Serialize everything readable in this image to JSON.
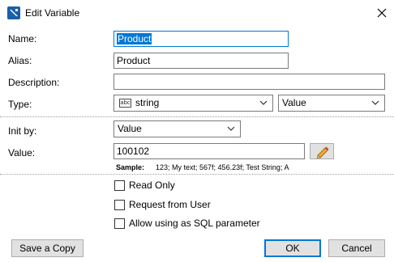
{
  "window": {
    "title": "Edit Variable",
    "icon": "app-icon",
    "close_icon": "close-icon"
  },
  "fields": {
    "name": {
      "label": "Name:",
      "value": "Product"
    },
    "alias": {
      "label": "Alias:",
      "value": "Product"
    },
    "description": {
      "label": "Description:",
      "value": ""
    },
    "type": {
      "label": "Type:",
      "icon_text": "abc",
      "value": "string",
      "kind": "Value"
    },
    "init_by": {
      "label": "Init by:",
      "value": "Value"
    },
    "value": {
      "label": "Value:",
      "value": "100102"
    }
  },
  "sample": {
    "label": "Sample:",
    "text": "123; My text; 567f; 456.23f; Test String; A"
  },
  "options": [
    {
      "label": "Read Only",
      "checked": false
    },
    {
      "label": "Request from User",
      "checked": false
    },
    {
      "label": "Allow using as SQL parameter",
      "checked": false
    }
  ],
  "buttons": {
    "save_copy": "Save a Copy",
    "ok": "OK",
    "cancel": "Cancel"
  },
  "colors": {
    "accent": "#0078d7",
    "button_face": "#e1e1e1",
    "pencil_body": "#f0a830"
  }
}
